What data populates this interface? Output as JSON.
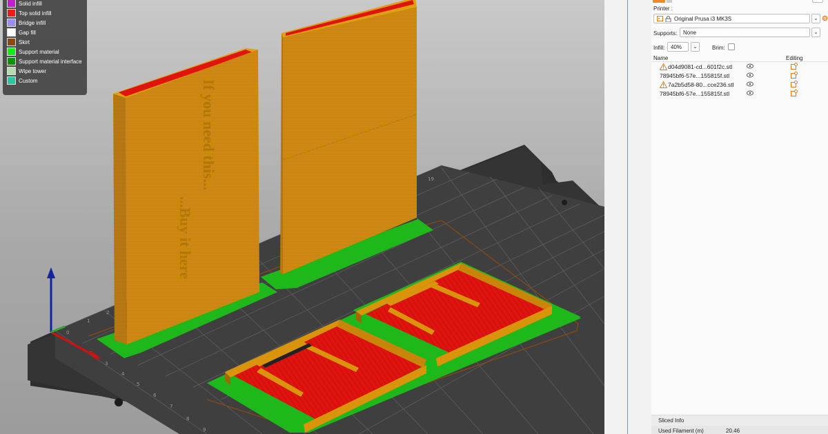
{
  "legend": {
    "items": [
      {
        "label": "Solid infill",
        "color": "#c21ecd"
      },
      {
        "label": "Top solid infill",
        "color": "#f01a1a"
      },
      {
        "label": "Bridge infill",
        "color": "#9a8ff2"
      },
      {
        "label": "Gap fill",
        "color": "#ffffff"
      },
      {
        "label": "Skirt",
        "color": "#8a4a14"
      },
      {
        "label": "Support material",
        "color": "#14ee14"
      },
      {
        "label": "Support material interface",
        "color": "#108f10"
      },
      {
        "label": "Wipe tower",
        "color": "#b5dcae"
      },
      {
        "label": "Custom",
        "color": "#28c79d"
      }
    ]
  },
  "scene": {
    "block_text_1": "If you need this...",
    "block_text_2": "...Buy it here",
    "colors": {
      "perimeter": "#d9940b",
      "top": "#e0130f",
      "support": "#1fb81a",
      "bed": "#3a3a3a",
      "axis_x": "#d11010",
      "axis_y": "#2ca82c",
      "axis_z": "#13249e"
    }
  },
  "sidebar": {
    "printer_label": "Printer :",
    "printer_value": "Original Prusa i3 MK3S",
    "supports_label": "Supports:",
    "supports_value": "None",
    "infill_label": "Infill:",
    "infill_value": "40%",
    "brim_label": "Brim:",
    "list_header_name": "Name",
    "list_header_editing": "Editing",
    "objects": [
      {
        "name": "d04d9081-cd...601f2c.stl",
        "warning": true
      },
      {
        "name": "78945bf6-57e...155815f.stl",
        "warning": false
      },
      {
        "name": "7a2b5d58-80...cce236.stl",
        "warning": true
      },
      {
        "name": "78945bf6-57e...155815f.stl",
        "warning": false
      }
    ],
    "sliced_info_title": "Sliced Info",
    "used_filament_label": "Used Filament (m)",
    "used_filament_value": "20.46"
  }
}
